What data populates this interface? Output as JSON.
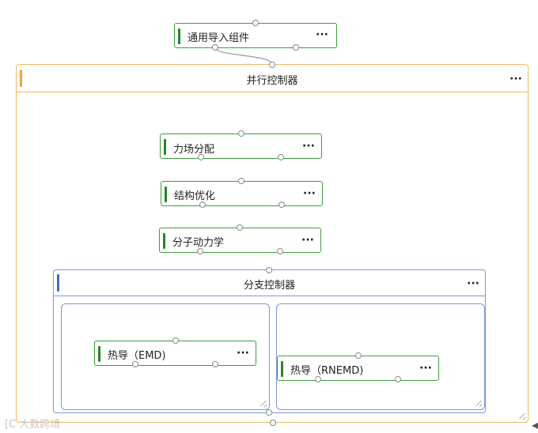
{
  "nodes": {
    "generic_import": "通用导入组件",
    "force_field": "力场分配",
    "structure_opt": "结构优化",
    "molecular_dynamics": "分子动力学",
    "thermal_emd": "热导（EMD)",
    "thermal_rnemd": "热导（RNEMD)"
  },
  "containers": {
    "parallel": "并行控制器",
    "branch": "分支控制器"
  },
  "more_label": "···",
  "watermark": "[C 大数跨境",
  "colors": {
    "node_border": "#3f9b3f",
    "node_bar": "#1e8a1e",
    "parallel_border": "#f2b866",
    "parallel_bar": "#f0a640",
    "branch_border": "#7a98d8",
    "branch_bar": "#3a6fc6",
    "link": "#999999"
  }
}
